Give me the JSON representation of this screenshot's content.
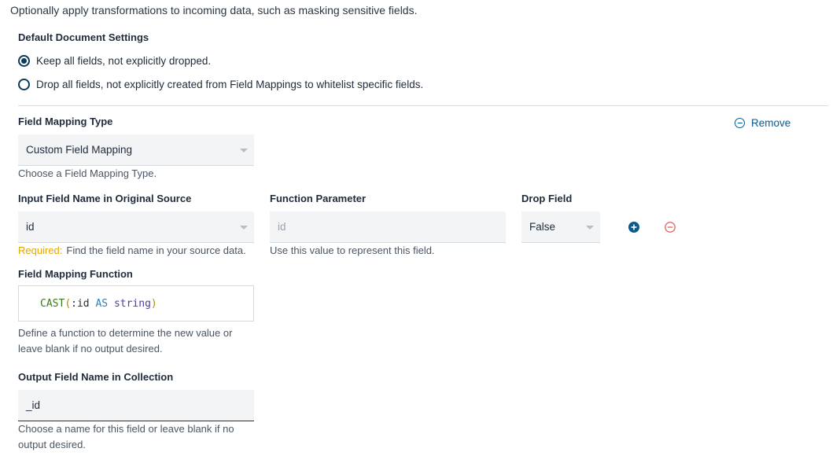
{
  "intro": "Optionally apply transformations to incoming data, such as masking sensitive fields.",
  "default_settings": {
    "title": "Default Document Settings",
    "options": [
      {
        "label": "Keep all fields, not explicitly dropped.",
        "selected": true
      },
      {
        "label": "Drop all fields, not explicitly created from Field Mappings to whitelist specific fields.",
        "selected": false
      }
    ]
  },
  "mapping_type": {
    "label": "Field Mapping Type",
    "value": "Custom Field Mapping",
    "helper": "Choose a Field Mapping Type.",
    "remove_label": "Remove"
  },
  "input_field": {
    "label": "Input Field Name in Original Source",
    "value": "id",
    "required_label": "Required:",
    "helper": "Find the field name in your source data."
  },
  "function_param": {
    "label": "Function Parameter",
    "value": "id",
    "helper": "Use this value to represent this field."
  },
  "drop_field": {
    "label": "Drop Field",
    "value": "False"
  },
  "mapping_function": {
    "label": "Field Mapping Function",
    "tokens": {
      "fn": "CAST",
      "open": "(",
      "param": ":id",
      "kw": "AS",
      "type": "string",
      "close": ")"
    },
    "helper_line1": "Define a function to determine the new value or",
    "helper_line2": "leave blank if no output desired."
  },
  "output_field": {
    "label": "Output Field Name in Collection",
    "value": "_id",
    "helper_line1": "Choose a name for this field or leave blank if no",
    "helper_line2": "output desired."
  },
  "colors": {
    "accent": "#0b5a8c",
    "radio": "#0b3b5c",
    "required": "#e0a800",
    "delete": "#e36b6b"
  },
  "icons": {
    "remove": "minus-circle-icon",
    "add": "plus-circle-icon",
    "delete": "minus-circle-outline-icon",
    "dropdown": "chevron-down-icon"
  }
}
